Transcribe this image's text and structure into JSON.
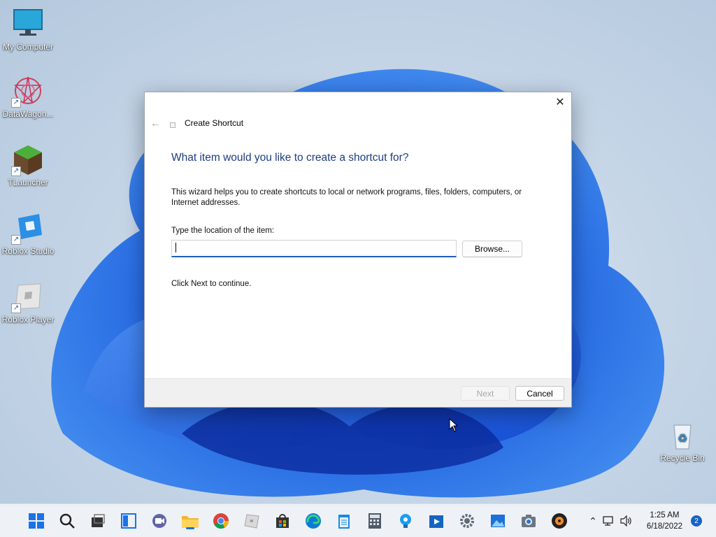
{
  "desktop": {
    "icons": [
      {
        "label": "My Computer"
      },
      {
        "label": "DataWagon..."
      },
      {
        "label": "TLauncher"
      },
      {
        "label": "Roblox Studio"
      },
      {
        "label": "Roblox Player"
      },
      {
        "label": "Recycle Bin"
      }
    ]
  },
  "dialog": {
    "title": "Create Shortcut",
    "heading": "What item would you like to create a shortcut for?",
    "description": "This wizard helps you to create shortcuts to local or network programs, files, folders, computers, or Internet addresses.",
    "location_label": "Type the location of the item:",
    "location_value": "",
    "browse_label": "Browse...",
    "hint": "Click Next to continue.",
    "next_label": "Next",
    "cancel_label": "Cancel",
    "close_glyph": "✕",
    "back_glyph": "←"
  },
  "taskbar": {
    "apps": [
      "start-icon",
      "search-icon",
      "task-view-icon",
      "widgets-icon",
      "chat-icon",
      "file-explorer-icon",
      "chrome-icon",
      "roblox-icon",
      "store-icon",
      "edge-icon",
      "notepad-icon",
      "calculator-icon",
      "tips-icon",
      "media-player-icon",
      "settings-icon",
      "photos-icon",
      "camera-icon",
      "music-icon"
    ],
    "clock_time": "1:25 AM",
    "clock_date": "6/18/2022",
    "notification_count": "2"
  },
  "colors": {
    "accent": "#1a63c7",
    "heading": "#1d3e7d"
  }
}
